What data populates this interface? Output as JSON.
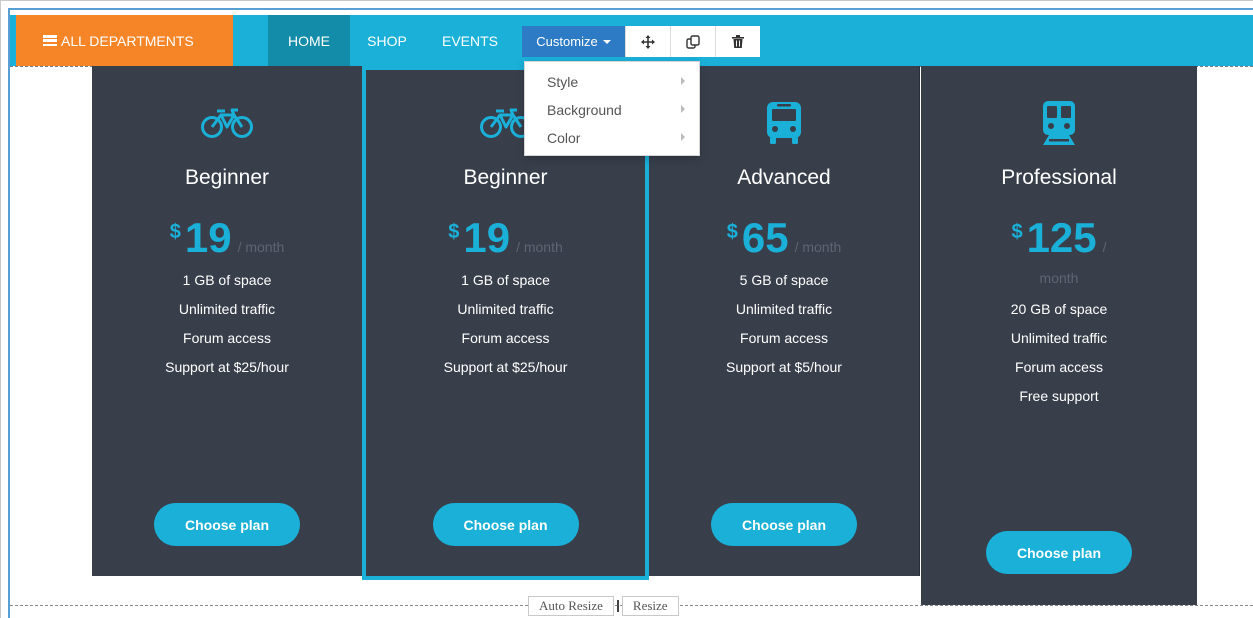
{
  "nav": {
    "departments_label": "ALL DEPARTMENTS",
    "links": [
      "HOME",
      "SHOP",
      "EVENTS"
    ],
    "active": "HOME"
  },
  "toolbar": {
    "customize_label": "Customize"
  },
  "customize_menu": {
    "items": [
      "Style",
      "Background",
      "Color"
    ]
  },
  "plans": [
    {
      "icon": "bicycle-icon",
      "title": "Beginner",
      "currency": "$",
      "price": "19",
      "period": "/ month",
      "features": [
        "1 GB of space",
        "Unlimited traffic",
        "Forum access",
        "Support at $25/hour"
      ],
      "button": "Choose plan"
    },
    {
      "icon": "bicycle-icon",
      "title": "Beginner",
      "currency": "$",
      "price": "19",
      "period": "/ month",
      "features": [
        "1 GB of space",
        "Unlimited traffic",
        "Forum access",
        "Support at $25/hour"
      ],
      "button": "Choose plan"
    },
    {
      "icon": "bus-icon",
      "title": "Advanced",
      "currency": "$",
      "price": "65",
      "period": "/ month",
      "features": [
        "5 GB of space",
        "Unlimited traffic",
        "Forum access",
        "Support at $5/hour"
      ],
      "button": "Choose plan"
    },
    {
      "icon": "train-icon",
      "title": "Professional",
      "currency": "$",
      "price": "125",
      "period_a": "/",
      "period_b": "month",
      "features": [
        "20 GB of space",
        "Unlimited traffic",
        "Forum access",
        "Free support"
      ],
      "button": "Choose plan"
    }
  ],
  "resize": {
    "auto_label": "Auto Resize",
    "resize_label": "Resize"
  },
  "colors": {
    "nav_bg": "#1ab0d8",
    "dept_bg": "#f68528",
    "card_bg": "#383f4b",
    "accent": "#1ab0d8"
  }
}
